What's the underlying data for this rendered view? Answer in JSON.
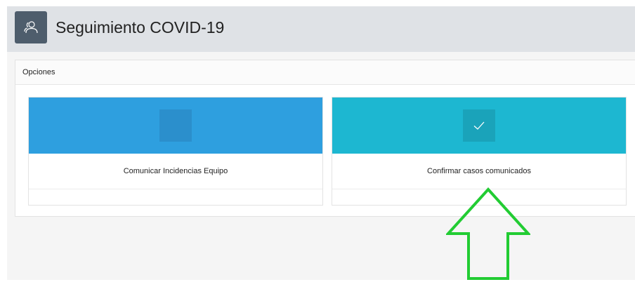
{
  "header": {
    "title": "Seguimiento COVID-19",
    "icon": "users-icon"
  },
  "region": {
    "title": "Opciones"
  },
  "cards": [
    {
      "title": "Comunicar Incidencias Equipo",
      "band_color": "#2e9fdf",
      "icon_box_color": "#2b8fcc",
      "icon": "blank-icon"
    },
    {
      "title": "Confirmar casos comunicados",
      "band_color": "#1db7d1",
      "icon_box_color": "#1aa3ba",
      "icon": "check-icon"
    }
  ],
  "annotation": {
    "arrow_color": "#22cc33",
    "arrow_direction": "up"
  }
}
